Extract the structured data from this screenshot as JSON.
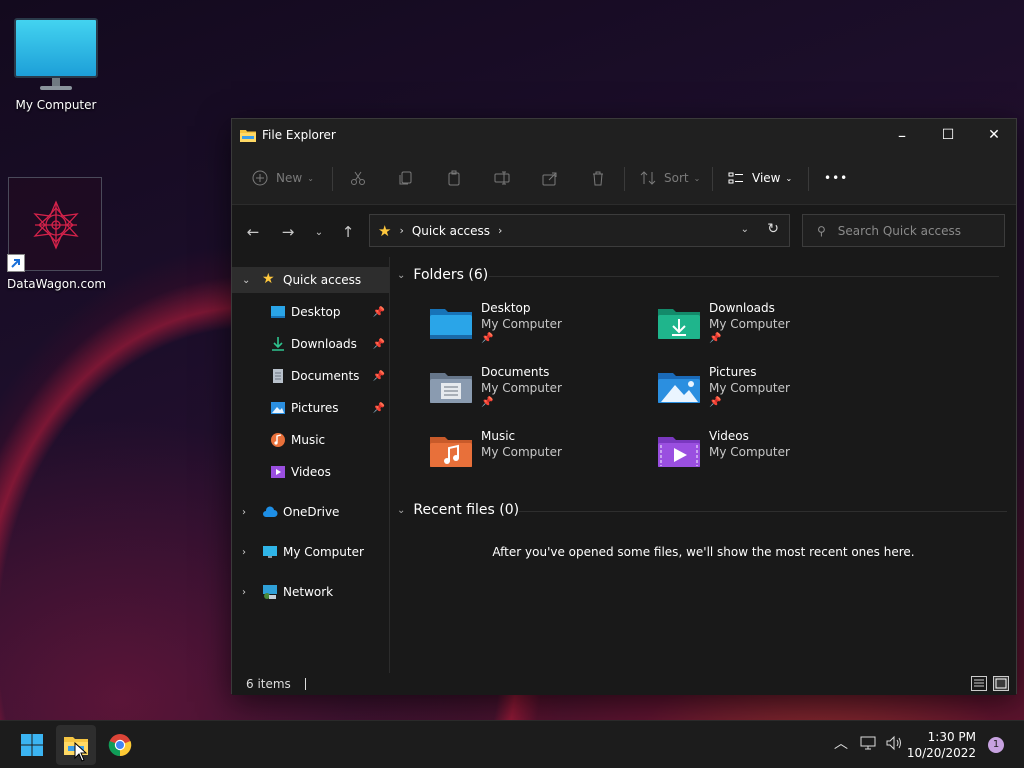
{
  "desktop": {
    "icons": [
      {
        "label": "My Computer"
      },
      {
        "label": "DataWagon.com"
      }
    ]
  },
  "window": {
    "title": "File Explorer",
    "controls": {
      "minimize": "–",
      "maximize": "☐",
      "close": "✕"
    }
  },
  "toolbar": {
    "new_label": "New",
    "sort_label": "Sort",
    "view_label": "View",
    "more_label": "•••",
    "icons": [
      "cut-icon",
      "copy-icon",
      "paste-icon",
      "rename-icon",
      "share-icon",
      "delete-icon"
    ]
  },
  "address": {
    "crumb": "Quick access",
    "search_placeholder": "Search Quick access"
  },
  "nav": {
    "items": [
      {
        "label": "Quick access",
        "icon": "star-icon"
      },
      {
        "label": "Desktop",
        "icon": "desktop-folder-icon",
        "pinned": true
      },
      {
        "label": "Downloads",
        "icon": "download-icon",
        "pinned": true
      },
      {
        "label": "Documents",
        "icon": "document-icon",
        "pinned": true
      },
      {
        "label": "Pictures",
        "icon": "pictures-icon",
        "pinned": true
      },
      {
        "label": "Music",
        "icon": "music-icon"
      },
      {
        "label": "Videos",
        "icon": "videos-icon"
      },
      {
        "label": "OneDrive",
        "icon": "cloud-icon"
      },
      {
        "label": "My Computer",
        "icon": "computer-icon"
      },
      {
        "label": "Network",
        "icon": "network-icon"
      }
    ]
  },
  "content": {
    "folders_header": "Folders (6)",
    "folders": [
      {
        "name": "Desktop",
        "location": "My Computer",
        "pinned": true,
        "color": "#2aa5e8"
      },
      {
        "name": "Downloads",
        "location": "My Computer",
        "pinned": true,
        "color": "#1fb58c"
      },
      {
        "name": "Documents",
        "location": "My Computer",
        "pinned": true,
        "color": "#8a9bb0"
      },
      {
        "name": "Pictures",
        "location": "My Computer",
        "pinned": true,
        "color": "#2b8fe0"
      },
      {
        "name": "Music",
        "location": "My Computer",
        "pinned": false,
        "color": "#e8703a"
      },
      {
        "name": "Videos",
        "location": "My Computer",
        "pinned": false,
        "color": "#9a4fe0"
      }
    ],
    "recent_header": "Recent files (0)",
    "recent_empty": "After you've opened some files, we'll show the most recent ones here."
  },
  "status": {
    "item_count": "6 items"
  },
  "taskbar": {
    "time": "1:30 PM",
    "date": "10/20/2022",
    "notification_count": "1"
  },
  "colors": {
    "accent": "#ffc83d",
    "window_bg": "#191919",
    "taskbar_bg": "#1c1c1c"
  }
}
